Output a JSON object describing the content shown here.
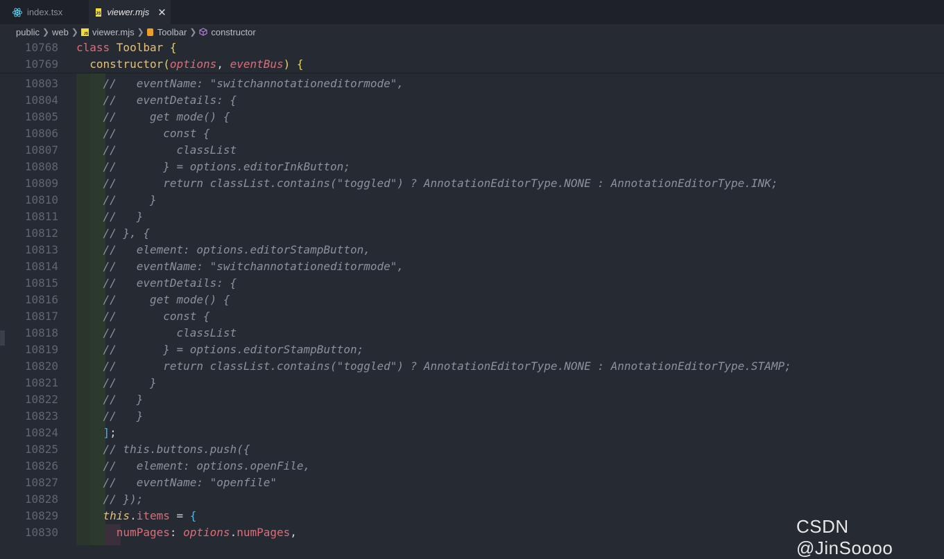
{
  "tabs": [
    {
      "label": "index.tsx",
      "icon": "react-icon"
    },
    {
      "label": "viewer.mjs",
      "icon": "js-file-icon",
      "close": "✕"
    }
  ],
  "breadcrumb": [
    "public",
    "web",
    "viewer.mjs",
    "Toolbar",
    "constructor"
  ],
  "sticky_lines": [
    {
      "num": "10768",
      "parts": [
        [
          "kw2",
          "class "
        ],
        [
          "cls",
          "Toolbar "
        ],
        [
          "punc",
          "{"
        ]
      ]
    },
    {
      "num": "10769",
      "parts": [
        [
          "plain",
          "  "
        ],
        [
          "fn",
          "constructor"
        ],
        [
          "punc",
          "("
        ],
        [
          "param",
          "options"
        ],
        [
          "plain",
          ", "
        ],
        [
          "param",
          "eventBus"
        ],
        [
          "punc",
          ") {"
        ]
      ]
    }
  ],
  "lines": [
    {
      "num": "10803",
      "parts": [
        [
          "plain",
          "    "
        ],
        [
          "cm",
          "//   eventName: \"switchannotationeditormode\","
        ]
      ]
    },
    {
      "num": "10804",
      "parts": [
        [
          "plain",
          "    "
        ],
        [
          "cm",
          "//   eventDetails: {"
        ]
      ]
    },
    {
      "num": "10805",
      "parts": [
        [
          "plain",
          "    "
        ],
        [
          "cm",
          "//     get mode() {"
        ]
      ]
    },
    {
      "num": "10806",
      "parts": [
        [
          "plain",
          "    "
        ],
        [
          "cm",
          "//       const {"
        ]
      ]
    },
    {
      "num": "10807",
      "parts": [
        [
          "plain",
          "    "
        ],
        [
          "cm",
          "//         classList"
        ]
      ]
    },
    {
      "num": "10808",
      "parts": [
        [
          "plain",
          "    "
        ],
        [
          "cm",
          "//       } = options.editorInkButton;"
        ]
      ]
    },
    {
      "num": "10809",
      "parts": [
        [
          "plain",
          "    "
        ],
        [
          "cm",
          "//       return classList.contains(\"toggled\") ? AnnotationEditorType.NONE : AnnotationEditorType.INK;"
        ]
      ]
    },
    {
      "num": "10810",
      "parts": [
        [
          "plain",
          "    "
        ],
        [
          "cm",
          "//     }"
        ]
      ]
    },
    {
      "num": "10811",
      "parts": [
        [
          "plain",
          "    "
        ],
        [
          "cm",
          "//   }"
        ]
      ]
    },
    {
      "num": "10812",
      "parts": [
        [
          "plain",
          "    "
        ],
        [
          "cm",
          "// }, {"
        ]
      ]
    },
    {
      "num": "10813",
      "parts": [
        [
          "plain",
          "    "
        ],
        [
          "cm",
          "//   element: options.editorStampButton,"
        ]
      ]
    },
    {
      "num": "10814",
      "parts": [
        [
          "plain",
          "    "
        ],
        [
          "cm",
          "//   eventName: \"switchannotationeditormode\","
        ]
      ]
    },
    {
      "num": "10815",
      "parts": [
        [
          "plain",
          "    "
        ],
        [
          "cm",
          "//   eventDetails: {"
        ]
      ]
    },
    {
      "num": "10816",
      "parts": [
        [
          "plain",
          "    "
        ],
        [
          "cm",
          "//     get mode() {"
        ]
      ]
    },
    {
      "num": "10817",
      "parts": [
        [
          "plain",
          "    "
        ],
        [
          "cm",
          "//       const {"
        ]
      ]
    },
    {
      "num": "10818",
      "parts": [
        [
          "plain",
          "    "
        ],
        [
          "cm",
          "//         classList"
        ]
      ]
    },
    {
      "num": "10819",
      "parts": [
        [
          "plain",
          "    "
        ],
        [
          "cm",
          "//       } = options.editorStampButton;"
        ]
      ]
    },
    {
      "num": "10820",
      "parts": [
        [
          "plain",
          "    "
        ],
        [
          "cm",
          "//       return classList.contains(\"toggled\") ? AnnotationEditorType.NONE : AnnotationEditorType.STAMP;"
        ]
      ]
    },
    {
      "num": "10821",
      "parts": [
        [
          "plain",
          "    "
        ],
        [
          "cm",
          "//     }"
        ]
      ]
    },
    {
      "num": "10822",
      "parts": [
        [
          "plain",
          "    "
        ],
        [
          "cm",
          "//   }"
        ]
      ]
    },
    {
      "num": "10823",
      "parts": [
        [
          "plain",
          "    "
        ],
        [
          "cm",
          "//   }"
        ]
      ]
    },
    {
      "num": "10824",
      "parts": [
        [
          "plain",
          "    "
        ],
        [
          "bracket",
          "]"
        ],
        [
          "plain",
          ";"
        ]
      ]
    },
    {
      "num": "10825",
      "parts": [
        [
          "plain",
          "    "
        ],
        [
          "cm",
          "// this.buttons.push({"
        ]
      ]
    },
    {
      "num": "10826",
      "parts": [
        [
          "plain",
          "    "
        ],
        [
          "cm",
          "//   element: options.openFile,"
        ]
      ]
    },
    {
      "num": "10827",
      "parts": [
        [
          "plain",
          "    "
        ],
        [
          "cm",
          "//   eventName: \"openfile\""
        ]
      ]
    },
    {
      "num": "10828",
      "parts": [
        [
          "plain",
          "    "
        ],
        [
          "cm",
          "// });"
        ]
      ]
    },
    {
      "num": "10829",
      "parts": [
        [
          "plain",
          "    "
        ],
        [
          "this",
          "this"
        ],
        [
          "plain",
          "."
        ],
        [
          "prop",
          "items"
        ],
        [
          "plain",
          " = "
        ],
        [
          "bracket",
          "{"
        ]
      ]
    },
    {
      "num": "10830",
      "parts": [
        [
          "plain",
          "      "
        ],
        [
          "prop",
          "numPages"
        ],
        [
          "plain",
          ": "
        ],
        [
          "param",
          "options"
        ],
        [
          "plain",
          "."
        ],
        [
          "prop",
          "numPages"
        ],
        [
          "plain",
          ","
        ]
      ]
    }
  ],
  "watermark": "CSDN @JinSoooo"
}
